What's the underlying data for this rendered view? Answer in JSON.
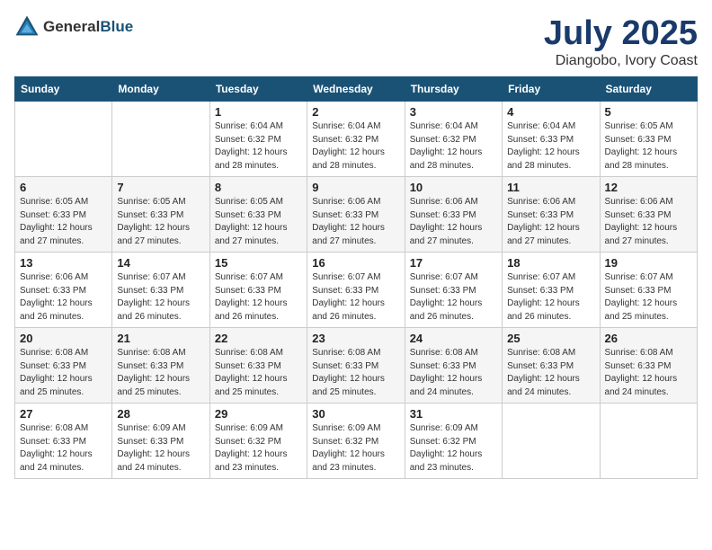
{
  "header": {
    "logo_general": "General",
    "logo_blue": "Blue",
    "month_year": "July 2025",
    "location": "Diangobo, Ivory Coast"
  },
  "weekdays": [
    "Sunday",
    "Monday",
    "Tuesday",
    "Wednesday",
    "Thursday",
    "Friday",
    "Saturday"
  ],
  "weeks": [
    [
      {
        "day": "",
        "info": ""
      },
      {
        "day": "",
        "info": ""
      },
      {
        "day": "1",
        "info": "Sunrise: 6:04 AM\nSunset: 6:32 PM\nDaylight: 12 hours and 28 minutes."
      },
      {
        "day": "2",
        "info": "Sunrise: 6:04 AM\nSunset: 6:32 PM\nDaylight: 12 hours and 28 minutes."
      },
      {
        "day": "3",
        "info": "Sunrise: 6:04 AM\nSunset: 6:32 PM\nDaylight: 12 hours and 28 minutes."
      },
      {
        "day": "4",
        "info": "Sunrise: 6:04 AM\nSunset: 6:33 PM\nDaylight: 12 hours and 28 minutes."
      },
      {
        "day": "5",
        "info": "Sunrise: 6:05 AM\nSunset: 6:33 PM\nDaylight: 12 hours and 28 minutes."
      }
    ],
    [
      {
        "day": "6",
        "info": "Sunrise: 6:05 AM\nSunset: 6:33 PM\nDaylight: 12 hours and 27 minutes."
      },
      {
        "day": "7",
        "info": "Sunrise: 6:05 AM\nSunset: 6:33 PM\nDaylight: 12 hours and 27 minutes."
      },
      {
        "day": "8",
        "info": "Sunrise: 6:05 AM\nSunset: 6:33 PM\nDaylight: 12 hours and 27 minutes."
      },
      {
        "day": "9",
        "info": "Sunrise: 6:06 AM\nSunset: 6:33 PM\nDaylight: 12 hours and 27 minutes."
      },
      {
        "day": "10",
        "info": "Sunrise: 6:06 AM\nSunset: 6:33 PM\nDaylight: 12 hours and 27 minutes."
      },
      {
        "day": "11",
        "info": "Sunrise: 6:06 AM\nSunset: 6:33 PM\nDaylight: 12 hours and 27 minutes."
      },
      {
        "day": "12",
        "info": "Sunrise: 6:06 AM\nSunset: 6:33 PM\nDaylight: 12 hours and 27 minutes."
      }
    ],
    [
      {
        "day": "13",
        "info": "Sunrise: 6:06 AM\nSunset: 6:33 PM\nDaylight: 12 hours and 26 minutes."
      },
      {
        "day": "14",
        "info": "Sunrise: 6:07 AM\nSunset: 6:33 PM\nDaylight: 12 hours and 26 minutes."
      },
      {
        "day": "15",
        "info": "Sunrise: 6:07 AM\nSunset: 6:33 PM\nDaylight: 12 hours and 26 minutes."
      },
      {
        "day": "16",
        "info": "Sunrise: 6:07 AM\nSunset: 6:33 PM\nDaylight: 12 hours and 26 minutes."
      },
      {
        "day": "17",
        "info": "Sunrise: 6:07 AM\nSunset: 6:33 PM\nDaylight: 12 hours and 26 minutes."
      },
      {
        "day": "18",
        "info": "Sunrise: 6:07 AM\nSunset: 6:33 PM\nDaylight: 12 hours and 26 minutes."
      },
      {
        "day": "19",
        "info": "Sunrise: 6:07 AM\nSunset: 6:33 PM\nDaylight: 12 hours and 25 minutes."
      }
    ],
    [
      {
        "day": "20",
        "info": "Sunrise: 6:08 AM\nSunset: 6:33 PM\nDaylight: 12 hours and 25 minutes."
      },
      {
        "day": "21",
        "info": "Sunrise: 6:08 AM\nSunset: 6:33 PM\nDaylight: 12 hours and 25 minutes."
      },
      {
        "day": "22",
        "info": "Sunrise: 6:08 AM\nSunset: 6:33 PM\nDaylight: 12 hours and 25 minutes."
      },
      {
        "day": "23",
        "info": "Sunrise: 6:08 AM\nSunset: 6:33 PM\nDaylight: 12 hours and 25 minutes."
      },
      {
        "day": "24",
        "info": "Sunrise: 6:08 AM\nSunset: 6:33 PM\nDaylight: 12 hours and 24 minutes."
      },
      {
        "day": "25",
        "info": "Sunrise: 6:08 AM\nSunset: 6:33 PM\nDaylight: 12 hours and 24 minutes."
      },
      {
        "day": "26",
        "info": "Sunrise: 6:08 AM\nSunset: 6:33 PM\nDaylight: 12 hours and 24 minutes."
      }
    ],
    [
      {
        "day": "27",
        "info": "Sunrise: 6:08 AM\nSunset: 6:33 PM\nDaylight: 12 hours and 24 minutes."
      },
      {
        "day": "28",
        "info": "Sunrise: 6:09 AM\nSunset: 6:33 PM\nDaylight: 12 hours and 24 minutes."
      },
      {
        "day": "29",
        "info": "Sunrise: 6:09 AM\nSunset: 6:32 PM\nDaylight: 12 hours and 23 minutes."
      },
      {
        "day": "30",
        "info": "Sunrise: 6:09 AM\nSunset: 6:32 PM\nDaylight: 12 hours and 23 minutes."
      },
      {
        "day": "31",
        "info": "Sunrise: 6:09 AM\nSunset: 6:32 PM\nDaylight: 12 hours and 23 minutes."
      },
      {
        "day": "",
        "info": ""
      },
      {
        "day": "",
        "info": ""
      }
    ]
  ]
}
